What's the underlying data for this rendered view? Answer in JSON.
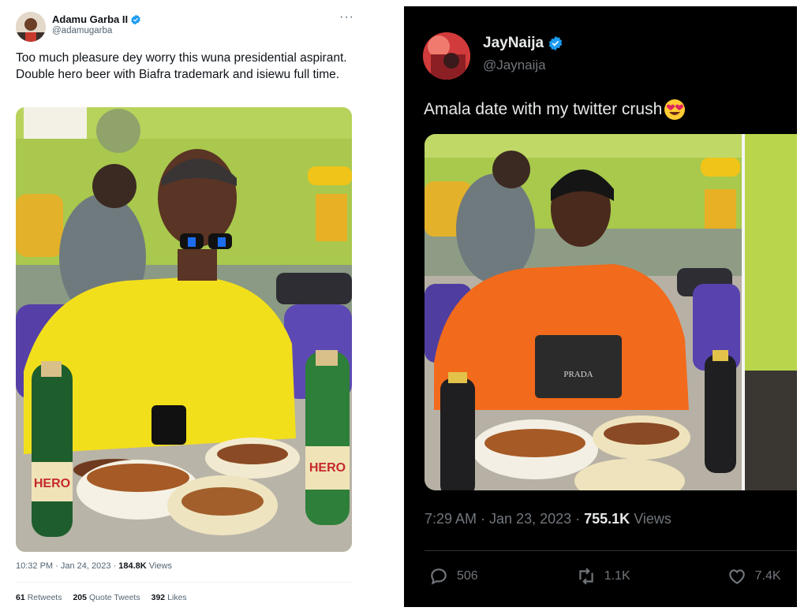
{
  "left_tweet": {
    "author_name": "Adamu Garba II",
    "handle": "@adamugarba",
    "text": "Too much pleasure dey worry this wuna presidential aspirant. Double hero beer with Biafra trademark and isiewu full time.",
    "bottle_label": "HERO",
    "timestamp": "10:32 PM · Jan 24, 2023 · ",
    "views_count": "184.8K",
    "views_label": "Views",
    "retweets_count": "61",
    "retweets_label": "Retweets",
    "quotes_count": "205",
    "quotes_label": "Quote Tweets",
    "likes_count": "392",
    "likes_label": "Likes"
  },
  "right_tweet": {
    "author_name": "JayNaija",
    "handle": "@Jaynaija",
    "text": "Amala date with my twitter crush",
    "shirt_label": "PRADA",
    "timestamp": "7:29 AM · Jan 23, 2023 · ",
    "views_count": "755.1K",
    "views_label": "Views",
    "replies_count": "506",
    "retweets_count": "1.1K",
    "likes_count": "7.4K"
  },
  "colors": {
    "verified": "#1d9bf0",
    "light_secondary": "#536471",
    "dark_secondary": "#71767b",
    "yellow_shirt": "#f2df1c",
    "orange_shirt": "#f26a1b",
    "lime_wall": "#a6c94a"
  },
  "icons": [
    "verified-icon",
    "more-icon",
    "reply-icon",
    "retweet-icon",
    "like-icon",
    "heart-eyes-emoji"
  ]
}
